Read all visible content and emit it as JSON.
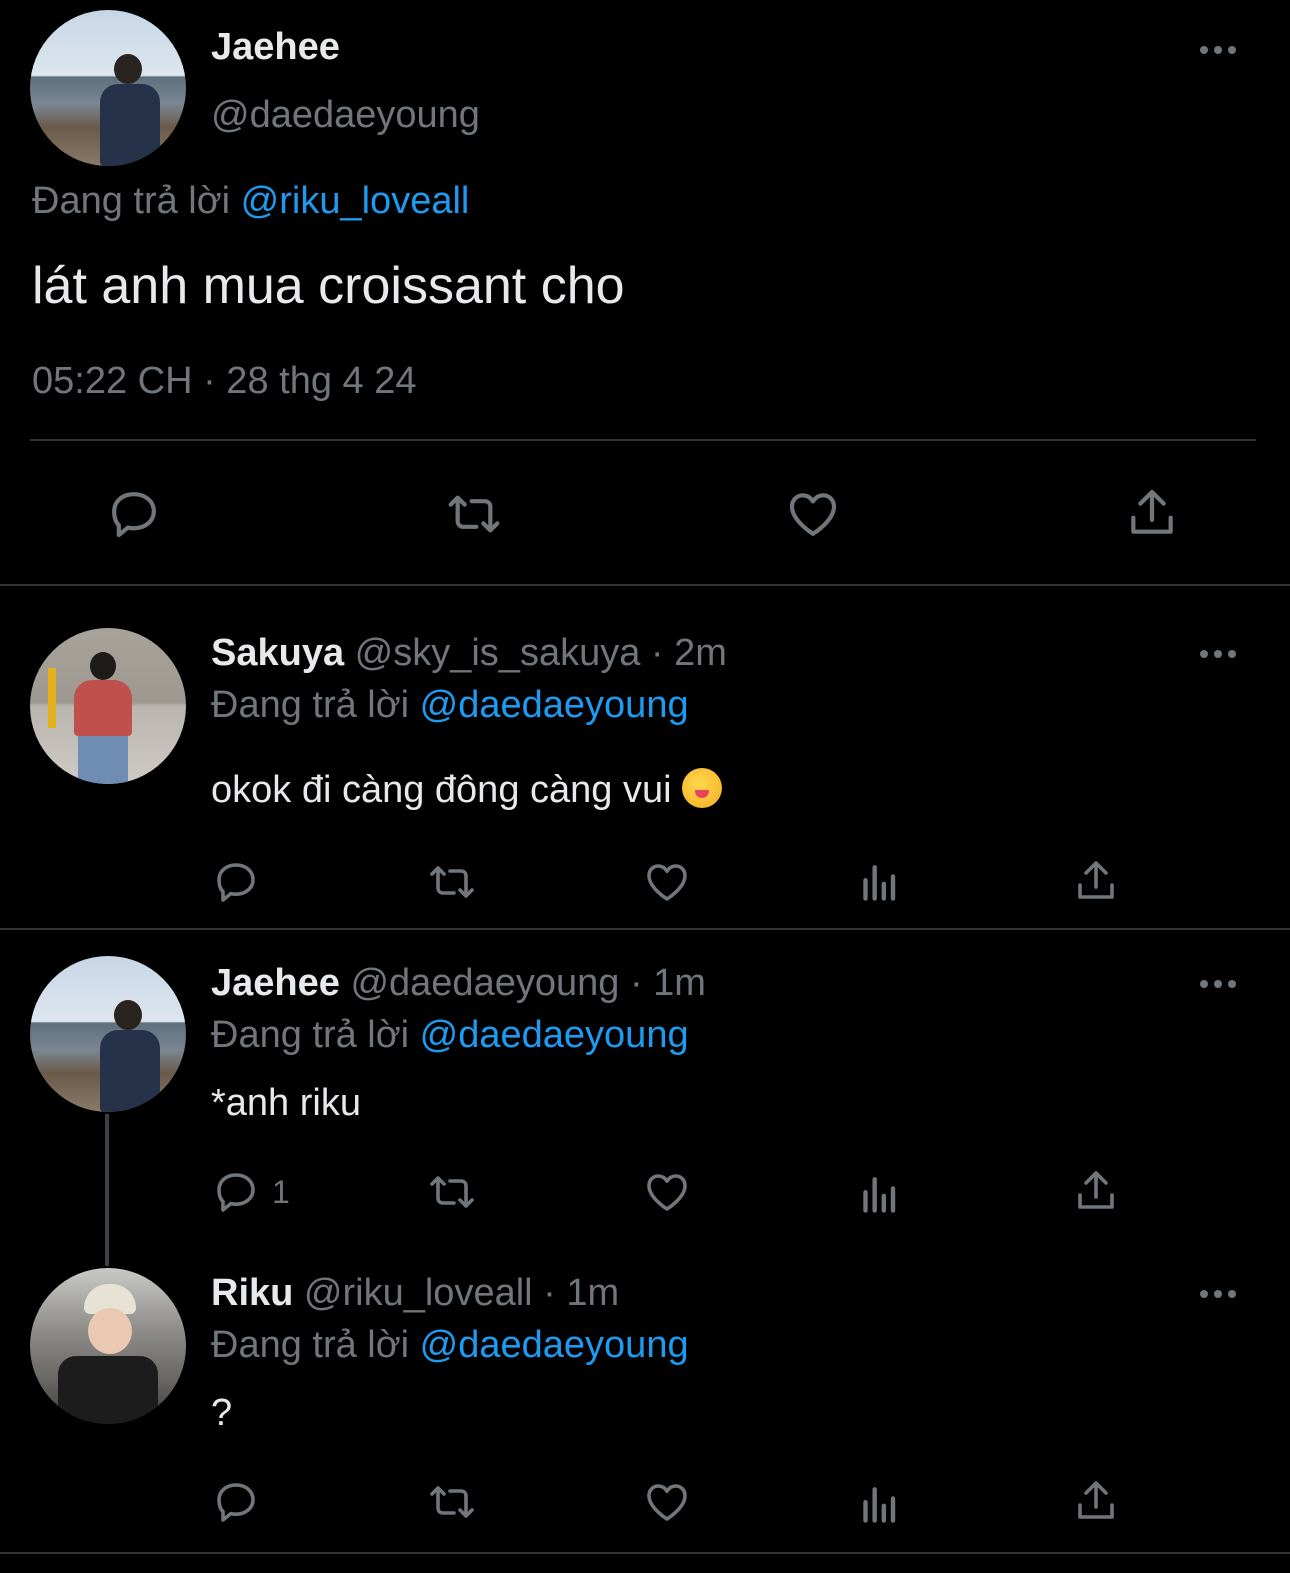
{
  "main_tweet": {
    "name": "Jaehee",
    "handle": "@daedaeyoung",
    "replying_prefix": "Đang trả lời",
    "replying_to": "@riku_loveall",
    "text": "lát anh mua croissant cho",
    "timestamp": "05:22 CH · 28 thg 4 24",
    "avatar_icon": "avatar-jaehee"
  },
  "replies": [
    {
      "name": "Sakuya",
      "handle": "@sky_is_sakuya",
      "time": "· 2m",
      "replying_prefix": "Đang trả lời",
      "replying_to": "@daedaeyoung",
      "text": "okok đi càng đông càng vui",
      "emoji": "yum-emoji",
      "reply_count": ""
    },
    {
      "name": "Jaehee",
      "handle": "@daedaeyoung",
      "time": "· 1m",
      "replying_prefix": "Đang trả lời",
      "replying_to": "@daedaeyoung",
      "text": "*anh riku",
      "reply_count": "1"
    },
    {
      "name": "Riku",
      "handle": "@riku_loveall",
      "time": "· 1m",
      "replying_prefix": "Đang trả lời",
      "replying_to": "@daedaeyoung",
      "text": "?",
      "reply_count": ""
    }
  ],
  "colors": {
    "background": "#000000",
    "text": "#e7e9ea",
    "muted": "#71767b",
    "link": "#1d9bf0",
    "divider": "#2f3336"
  }
}
